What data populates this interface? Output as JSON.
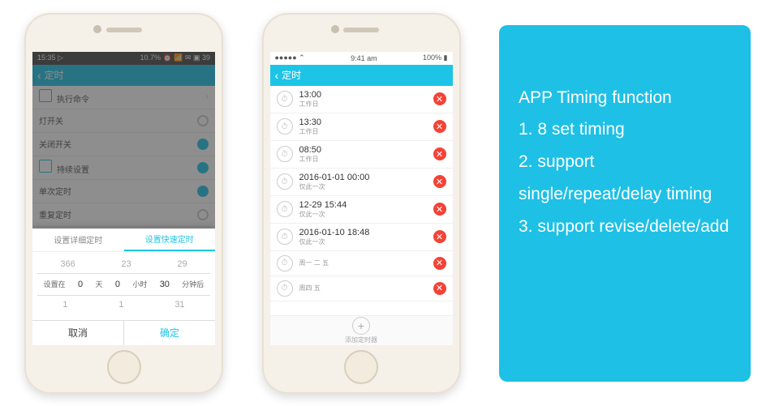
{
  "phone1": {
    "status": {
      "left": "15:35 ▷",
      "right": "10.7% ⏰ 📶 ✉ ▣ 39"
    },
    "header": {
      "back": "‹",
      "title": "定时"
    },
    "menu": [
      {
        "label": "执行命令",
        "toggle": null
      },
      {
        "label": "灯开关",
        "toggle": false
      },
      {
        "label": "关闭开关",
        "toggle": true
      },
      {
        "label": "持续设置",
        "toggle": true
      },
      {
        "label": "单次定时",
        "toggle": true
      },
      {
        "label": "重复定时",
        "toggle": false
      }
    ],
    "picker": {
      "tab1": "设置详细定时",
      "tab2": "设置快速定时",
      "row_top": [
        "366",
        "23",
        "29"
      ],
      "row_mid_labels": [
        "设置在",
        "天",
        "小时",
        "分钟后"
      ],
      "row_mid_vals": [
        "0",
        "0",
        "30"
      ],
      "row_bot": [
        "1",
        "1",
        "31"
      ],
      "cancel": "取消",
      "confirm": "确定"
    }
  },
  "phone2": {
    "status": {
      "left": "●●●●● ⌃",
      "center": "9:41 am",
      "right": "100% ▮"
    },
    "header": {
      "back": "‹",
      "title": "定时"
    },
    "timers": [
      {
        "time": "13:00",
        "sub": "工作日"
      },
      {
        "time": "13:30",
        "sub": "工作日"
      },
      {
        "time": "08:50",
        "sub": "工作日"
      },
      {
        "time": "2016-01-01 00:00",
        "sub": "仅此一次"
      },
      {
        "time": "12-29 15:44",
        "sub": "仅此一次"
      },
      {
        "time": "2016-01-10 18:48",
        "sub": "仅此一次"
      },
      {
        "time": "",
        "sub": "周一 二 五"
      },
      {
        "time": "",
        "sub": "周四 五"
      }
    ],
    "add_label": "添加定时器"
  },
  "info": {
    "title": "APP Timing function",
    "l1": "1. 8 set timing",
    "l2": "2. support single/repeat/delay timing",
    "l3": "3. support revise/delete/add"
  }
}
